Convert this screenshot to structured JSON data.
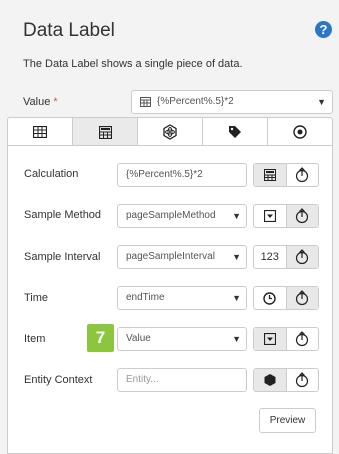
{
  "panel": {
    "title": "Data Label",
    "help_icon": "?",
    "description": "The Data Label shows a single piece of data.",
    "value_label": "Value",
    "required_mark": "*",
    "value_selected": "{%Percent%.5}*2"
  },
  "tabs": [
    {
      "icon": "table-icon"
    },
    {
      "icon": "calculator-icon",
      "active": true
    },
    {
      "icon": "atom-icon"
    },
    {
      "icon": "tag-icon"
    },
    {
      "icon": "radio-target-icon"
    }
  ],
  "rows": {
    "calculation": {
      "label": "Calculation",
      "value": "{%Percent%.5}*2"
    },
    "sample_method": {
      "label": "Sample Method",
      "value": "pageSampleMethod"
    },
    "sample_interval": {
      "label": "Sample Interval",
      "value": "pageSampleInterval",
      "button_text": "123"
    },
    "time": {
      "label": "Time",
      "value": "endTime"
    },
    "item": {
      "label": "Item",
      "value": "Value"
    },
    "entity_context": {
      "label": "Entity Context",
      "placeholder": "Entity..."
    }
  },
  "callout_badge": "7",
  "preview_button": "Preview",
  "colors": {
    "accent": "#2a78c4",
    "badge": "#8cc63f",
    "required": "#d9534f"
  }
}
